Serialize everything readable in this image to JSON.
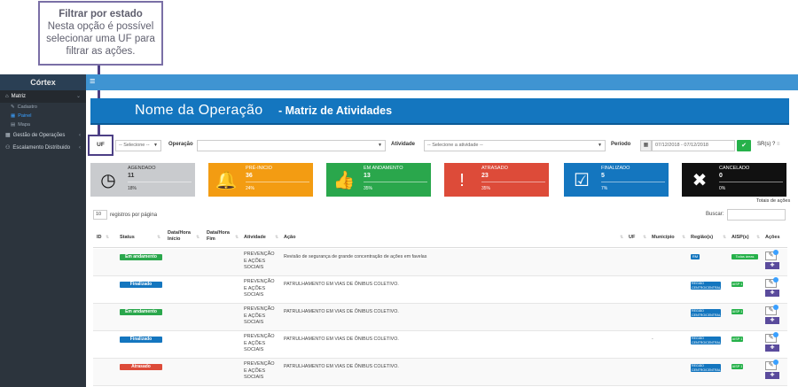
{
  "callout": {
    "title": "Filtrar por estado",
    "description": "Nesta opção é possível selecionar uma UF para filtrar as ações."
  },
  "sidebar": {
    "brand": "Córtex",
    "items": [
      {
        "label": "Matriz",
        "icon": "home-icon"
      },
      {
        "label": "Cadastro"
      },
      {
        "label": "Painel"
      },
      {
        "label": "Mapa"
      },
      {
        "label": "Gestão de Operações",
        "icon": "table-icon"
      },
      {
        "label": "Escalamento Distribuido",
        "icon": "users-icon"
      }
    ]
  },
  "banner": {
    "name": "Nome da Operação",
    "subtitle": "- Matriz de Atividades"
  },
  "filters": {
    "uf_label": "UF",
    "uf_select": "-- Selecione --",
    "operacao_label": "Operação",
    "atividade_label": "Atividade",
    "atividade_select": "-- Selecione a atividade --",
    "periodo_label": "Período",
    "periodo_value": "07/12/2018 - 07/12/2018",
    "extra_label": "SR(s) ?"
  },
  "cards": [
    {
      "label": "AGENDADO",
      "value": "11",
      "pct": "18%",
      "color": "#c9cbce",
      "text": "#333333",
      "icon": "clock-icon",
      "glyph": "◷"
    },
    {
      "label": "PRÉ-INICIO",
      "value": "36",
      "pct": "24%",
      "color": "#f39c12",
      "text": "#ffffff",
      "icon": "bell-icon",
      "glyph": "🔔"
    },
    {
      "label": "EM ANDAMENTO",
      "value": "13",
      "pct": "35%",
      "color": "#2aa74c",
      "text": "#ffffff",
      "icon": "thumbs-up-icon",
      "glyph": "👍"
    },
    {
      "label": "ATRASADO",
      "value": "23",
      "pct": "35%",
      "color": "#dd4b39",
      "text": "#ffffff",
      "icon": "exclamation-icon",
      "glyph": "!"
    },
    {
      "label": "FINALIZADO",
      "value": "5",
      "pct": "7%",
      "color": "#1476bf",
      "text": "#ffffff",
      "icon": "checkbox-icon",
      "glyph": "☑"
    },
    {
      "label": "CANCELADO",
      "value": "0",
      "pct": "0%",
      "color": "#111111",
      "text": "#ffffff",
      "icon": "x-icon",
      "glyph": "✖"
    }
  ],
  "totais": "Totais de ações",
  "table_controls": {
    "per_page_value": "10",
    "per_page_label": "registros por página",
    "search_label": "Buscar:"
  },
  "table": {
    "headers": {
      "id": "ID",
      "status": "Status",
      "inicio": "Data/Hora Início",
      "fim": "Data/Hora Fim",
      "atividade": "Atividade",
      "acao": "Ação",
      "uf": "UF",
      "municipio": "Município",
      "regiao": "Região(s)",
      "aisp": "AISP(s)",
      "acoes": "Ações"
    },
    "rows": [
      {
        "status": "Em andamento",
        "status_color": "#2aa74c",
        "atividade": "PREVENÇÃO E AÇÕES SOCIAIS",
        "acao": "Revisão de segurança de grande concentração de ações em favelas",
        "municipio": "",
        "regiao": "RM",
        "regiao_small": true,
        "aisp": "Todas áreas",
        "aisp_wide": true
      },
      {
        "status": "Finalizado",
        "status_color": "#1476bf",
        "atividade": "PREVENÇÃO E AÇÕES SOCIAIS",
        "acao": "PATRULHAMENTO EM VIAS DE ÔNIBUS COLETIVO.",
        "municipio": "",
        "regiao": "REGIÃO CENTRO/CENTRAL RM",
        "regiao_small": false,
        "aisp": "AISP 1",
        "aisp_wide": false
      },
      {
        "status": "Em andamento",
        "status_color": "#2aa74c",
        "atividade": "PREVENÇÃO E AÇÕES SOCIAIS",
        "acao": "PATRULHAMENTO EM VIAS DE ÔNIBUS COLETIVO.",
        "municipio": "",
        "regiao": "REGIÃO CENTRO/CENTRAL RM",
        "regiao_small": false,
        "aisp": "AISP 1",
        "aisp_wide": false
      },
      {
        "status": "Finalizado",
        "status_color": "#1476bf",
        "atividade": "PREVENÇÃO E AÇÕES SOCIAIS",
        "acao": "PATRULHAMENTO EM VIAS DE ÔNIBUS COLETIVO.",
        "municipio": "-",
        "regiao": "REGIÃO CENTRO/CENTRAL RM",
        "regiao_small": false,
        "aisp": "AISP 1",
        "aisp_wide": false
      },
      {
        "status": "Atrasado",
        "status_color": "#dd4b39",
        "atividade": "PREVENÇÃO E AÇÕES SOCIAIS",
        "acao": "PATRULHAMENTO EM VIAS DE ÔNIBUS COLETIVO.",
        "municipio": "",
        "regiao": "REGIÃO CENTRO/CENTRAL RM",
        "regiao_small": false,
        "aisp": "AISP 1",
        "aisp_wide": false
      }
    ]
  }
}
